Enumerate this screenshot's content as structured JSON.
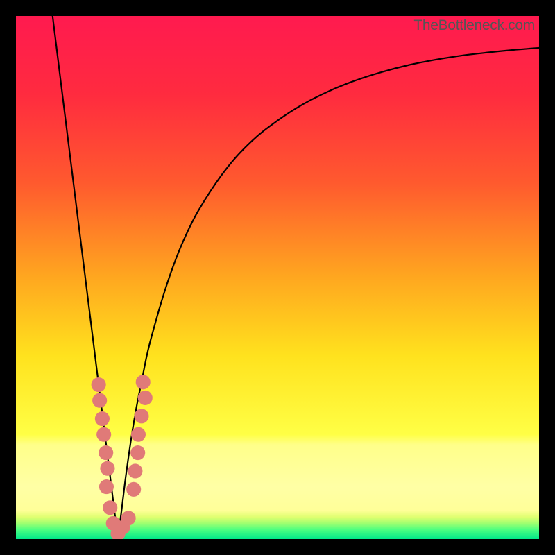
{
  "watermark": "TheBottleneck.com",
  "colors": {
    "frame": "#000000",
    "gradient_stops": [
      {
        "offset": 0.0,
        "color": "#ff1a4f"
      },
      {
        "offset": 0.15,
        "color": "#ff2b3f"
      },
      {
        "offset": 0.32,
        "color": "#ff5a2e"
      },
      {
        "offset": 0.5,
        "color": "#ffa71f"
      },
      {
        "offset": 0.65,
        "color": "#ffe21e"
      },
      {
        "offset": 0.8,
        "color": "#ffff45"
      },
      {
        "offset": 0.82,
        "color": "#ffff8a"
      },
      {
        "offset": 0.9,
        "color": "#ffffa5"
      },
      {
        "offset": 0.945,
        "color": "#ffff99"
      },
      {
        "offset": 0.958,
        "color": "#dfff70"
      },
      {
        "offset": 0.97,
        "color": "#9fff70"
      },
      {
        "offset": 0.982,
        "color": "#4dff80"
      },
      {
        "offset": 1.0,
        "color": "#00e889"
      }
    ],
    "curve": "#000000",
    "marker_fill": "#e07a78",
    "marker_stroke": "#c05a58"
  },
  "chart_data": {
    "type": "line",
    "title": "",
    "xlabel": "",
    "ylabel": "",
    "xlim": [
      0,
      100
    ],
    "ylim": [
      0,
      100
    ],
    "notch_x": 19.5,
    "series": [
      {
        "name": "bottleneck-curve",
        "x": [
          7.0,
          8,
          9,
          10,
          11,
          12,
          13,
          14,
          15,
          16,
          17,
          18,
          18.5,
          19,
          19.5,
          20,
          20.5,
          21,
          22,
          23,
          24,
          25,
          26,
          28,
          30,
          32,
          35,
          40,
          45,
          50,
          55,
          60,
          65,
          70,
          75,
          80,
          85,
          90,
          95,
          100
        ],
        "y": [
          100,
          92,
          84,
          76,
          68,
          60,
          52,
          44,
          36,
          28,
          20,
          12,
          8,
          4,
          0.5,
          4,
          8,
          12,
          19,
          25,
          30,
          35,
          39,
          46,
          52,
          57,
          63,
          70.5,
          76,
          80,
          83.2,
          85.7,
          87.7,
          89.3,
          90.6,
          91.6,
          92.4,
          93,
          93.5,
          93.9
        ]
      }
    ],
    "markers": [
      {
        "x": 15.8,
        "y": 29.5,
        "r": 1.4
      },
      {
        "x": 16.0,
        "y": 26.5,
        "r": 1.4
      },
      {
        "x": 16.5,
        "y": 23.0,
        "r": 1.4
      },
      {
        "x": 16.8,
        "y": 20.0,
        "r": 1.4
      },
      {
        "x": 17.2,
        "y": 16.5,
        "r": 1.4
      },
      {
        "x": 17.5,
        "y": 13.5,
        "r": 1.4
      },
      {
        "x": 17.3,
        "y": 10.0,
        "r": 1.4
      },
      {
        "x": 18.0,
        "y": 6.0,
        "r": 1.4
      },
      {
        "x": 18.6,
        "y": 3.0,
        "r": 1.4
      },
      {
        "x": 19.5,
        "y": 1.0,
        "r": 1.4
      },
      {
        "x": 20.4,
        "y": 2.2,
        "r": 1.4
      },
      {
        "x": 21.5,
        "y": 4.0,
        "r": 1.4
      },
      {
        "x": 22.5,
        "y": 9.5,
        "r": 1.4
      },
      {
        "x": 22.8,
        "y": 13.0,
        "r": 1.4
      },
      {
        "x": 23.3,
        "y": 16.5,
        "r": 1.4
      },
      {
        "x": 23.4,
        "y": 20.0,
        "r": 1.4
      },
      {
        "x": 24.0,
        "y": 23.5,
        "r": 1.4
      },
      {
        "x": 24.7,
        "y": 27.0,
        "r": 1.4
      },
      {
        "x": 24.3,
        "y": 30.0,
        "r": 1.4
      }
    ]
  }
}
